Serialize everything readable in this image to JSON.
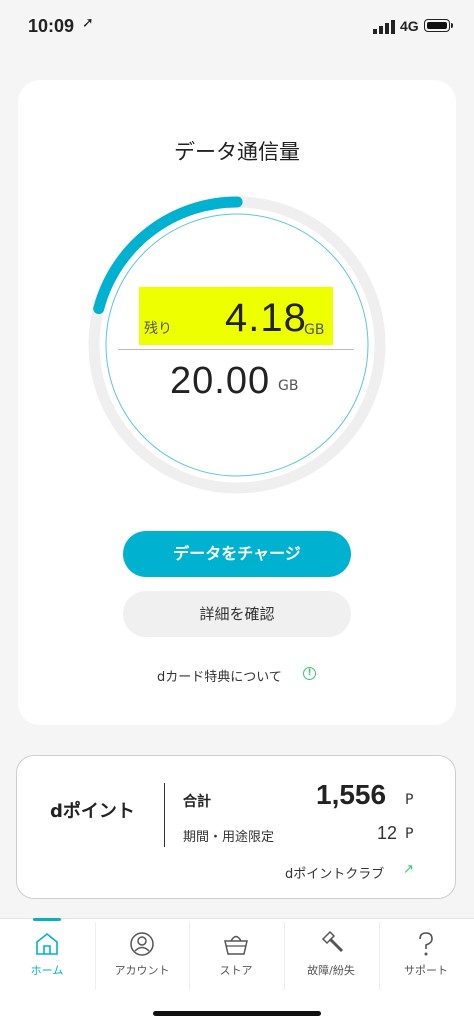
{
  "status_bar": {
    "time": "10:09",
    "network": "4G"
  },
  "data_card": {
    "title": "データ通信量",
    "remaining_label": "残り",
    "remaining_value": "4.18",
    "remaining_unit": "GB",
    "total_value": "20.00",
    "total_unit": "GB",
    "remaining_fraction": 0.209,
    "gauge_color": "#00b2cf",
    "charge_button": "データをチャージ",
    "detail_button": "詳細を確認",
    "dcard_link": "dカード特典について"
  },
  "dpoint_card": {
    "title": "dポイント",
    "total_label": "合計",
    "total_value": "1,556",
    "total_unit": "P",
    "limited_label": "期間・用途限定",
    "limited_value": "12",
    "limited_unit": "P",
    "club_link": "dポイントクラブ"
  },
  "tabs": [
    {
      "label": "ホーム",
      "icon": "home-icon",
      "active": true
    },
    {
      "label": "アカウント",
      "icon": "account-icon",
      "active": false
    },
    {
      "label": "ストア",
      "icon": "basket-icon",
      "active": false
    },
    {
      "label": "故障/紛失",
      "icon": "hammer-icon",
      "active": false
    },
    {
      "label": "サポート",
      "icon": "question-icon",
      "active": false
    }
  ],
  "colors": {
    "accent": "#00b2cf",
    "highlight": "#eeff00",
    "link_icon": "#2ecc71"
  }
}
